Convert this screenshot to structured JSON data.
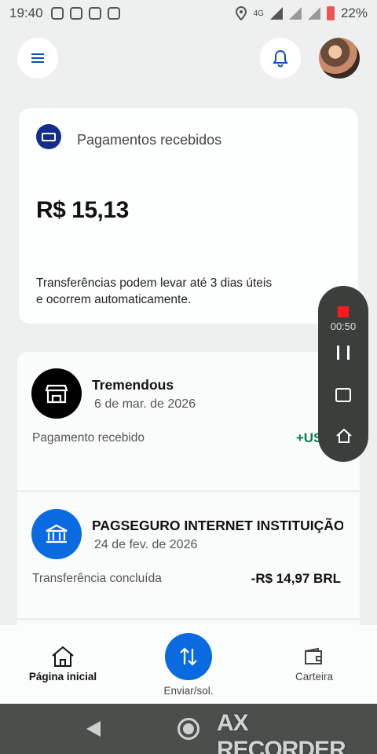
{
  "status_bar": {
    "time": "19:40",
    "battery": "22%",
    "network": "4G"
  },
  "header": {
    "menu_icon": "hamburger-menu-icon",
    "notification_icon": "bell-icon",
    "avatar_icon": "user-avatar"
  },
  "balance_card": {
    "icon": "money-bill-icon",
    "title": "Pagamentos recebidos",
    "amount": "R$ 15,13",
    "note": "Transferências podem levar até 3 dias úteis e ocorrem automaticamente."
  },
  "transactions": [
    {
      "name": "Tremendous",
      "date": "6 de mar. de 2026",
      "status": "Pagamento recebido",
      "amount": "+US$ 3",
      "icon": "storefront-icon"
    },
    {
      "name": "PAGSEGURO INTERNET INSTITUIÇÃO",
      "date": "24 de fev. de 2026",
      "status": "Transferência concluída",
      "amount": "-R$ 14,97 BRL",
      "icon": "bank-icon"
    }
  ],
  "recorder_overlay": {
    "elapsed": "00:50",
    "icons": [
      "stop-record-icon",
      "pause-icon",
      "screenshot-icon",
      "home-icon"
    ]
  },
  "bottom_nav": {
    "home_label": "Página inicial",
    "send_label": "Enviar/sol.",
    "wallet_label": "Carteira"
  },
  "watermark": "AX RECORDER",
  "colors": {
    "brand_blue": "#0a6ae0",
    "dark_blue": "#142c8e",
    "positive_green": "#0b7a4b"
  }
}
